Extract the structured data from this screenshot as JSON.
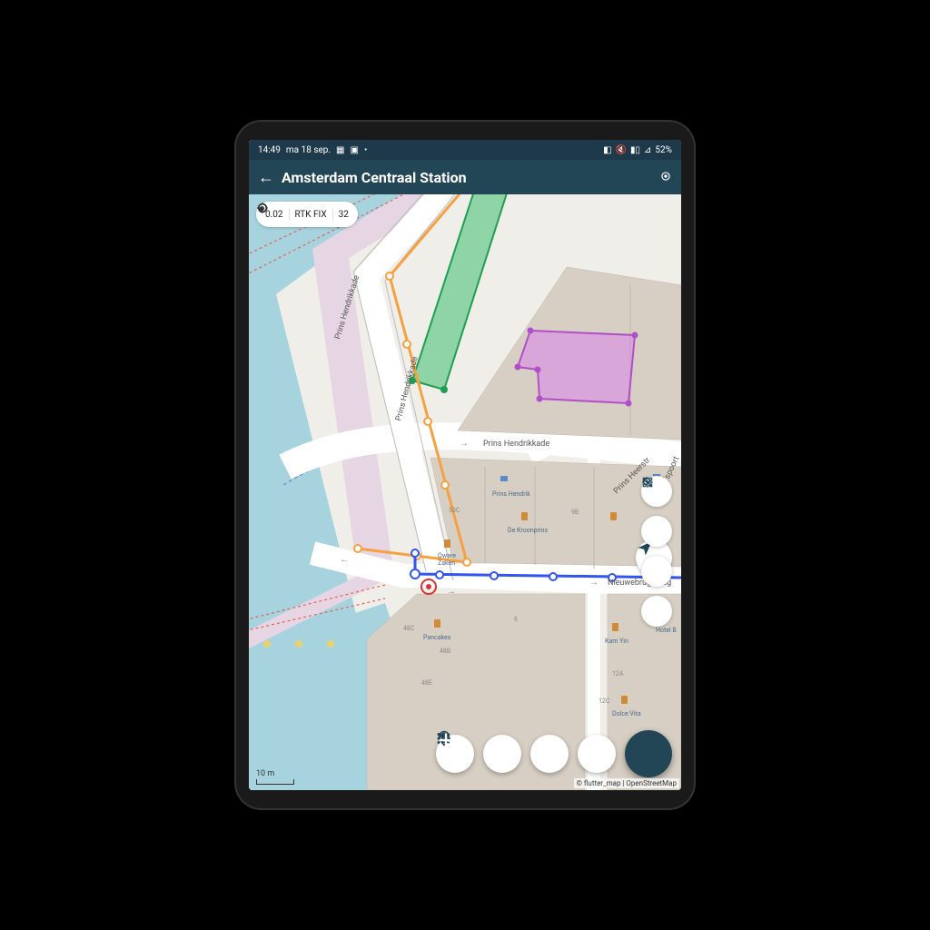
{
  "statusbar": {
    "time": "14:49",
    "date": "ma 18 sep.",
    "battery": "52%"
  },
  "appbar": {
    "title": "Amsterdam Centraal Station"
  },
  "gps_status": {
    "accuracy": "0.02",
    "mode": "RTK FIX",
    "sats": "32"
  },
  "streets": {
    "prins_hendrikkade": "Prins Hendrikkade",
    "nieuwebrugsteeg": "Nieuwebrugsteeg",
    "sint_olofspoort": "Sint Olofspoort",
    "heerstraat": "Prins Heerstr"
  },
  "pois": {
    "prins_hendrik": "Prins Hendrik",
    "de_kroonprins": "De Kroonprins",
    "oware_zaken": "Oware\nZaken",
    "pancakes": "Pancakes",
    "kam_yin": "Kam Yin",
    "dolce_vita": "Dolce Vita",
    "hotel_b": "Hotel B"
  },
  "buildings": {
    "b48c": "48C",
    "b48b": "48B",
    "b48e": "48E",
    "b50c": "50C",
    "b9b": "9B",
    "b12a": "12A",
    "b12c": "12C",
    "b6": "6"
  },
  "scale": "10 m",
  "attribution": "© flutter_map | OpenStreetMap",
  "shapes": {
    "green_rect": {
      "color": "#3fbf6f"
    },
    "purple_poly": {
      "color": "#d98be8"
    },
    "orange_line": {
      "color": "#f5a142"
    },
    "blue_line": {
      "color": "#3355ee"
    }
  }
}
